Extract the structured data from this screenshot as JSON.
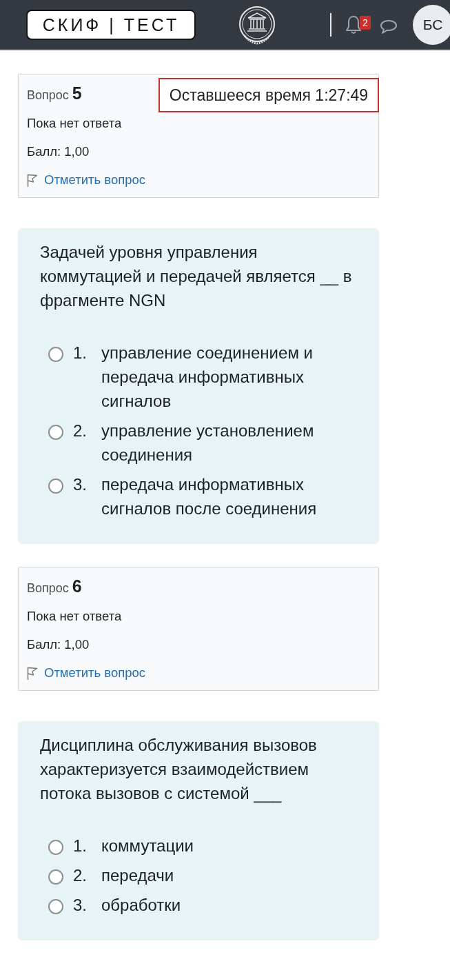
{
  "header": {
    "logo": "СКИФ | ТЕСТ",
    "notification_count": "2",
    "avatar_initials": "БС"
  },
  "timer": {
    "text": "Оставшееся время 1:27:49"
  },
  "questions": [
    {
      "label": "Вопрос",
      "number": "5",
      "status": "Пока нет ответа",
      "grade": "Балл: 1,00",
      "flag_link": "Отметить вопрос",
      "flagged": false,
      "text": "Задачей уровня управления коммутацией и передачей является __ в фрагменте NGN",
      "options": [
        {
          "number": "1.",
          "text": "управление соединением и передача информативных сигналов",
          "selected": false
        },
        {
          "number": "2.",
          "text": "управление установлением соединения",
          "selected": false
        },
        {
          "number": "3.",
          "text": "передача информативных сигналов после соединения",
          "selected": false
        }
      ]
    },
    {
      "label": "Вопрос",
      "number": "6",
      "status": "Пока нет ответа",
      "grade": "Балл: 1,00",
      "flag_link": "Отметить вопрос",
      "flagged": false,
      "text": "Дисциплина обслуживания вызовов характеризуется взаимодействием потока вызовов с системой ___",
      "options": [
        {
          "number": "1.",
          "text": "коммутации",
          "selected": false
        },
        {
          "number": "2.",
          "text": "передачи",
          "selected": false
        },
        {
          "number": "3.",
          "text": "обработки",
          "selected": false
        }
      ]
    }
  ]
}
